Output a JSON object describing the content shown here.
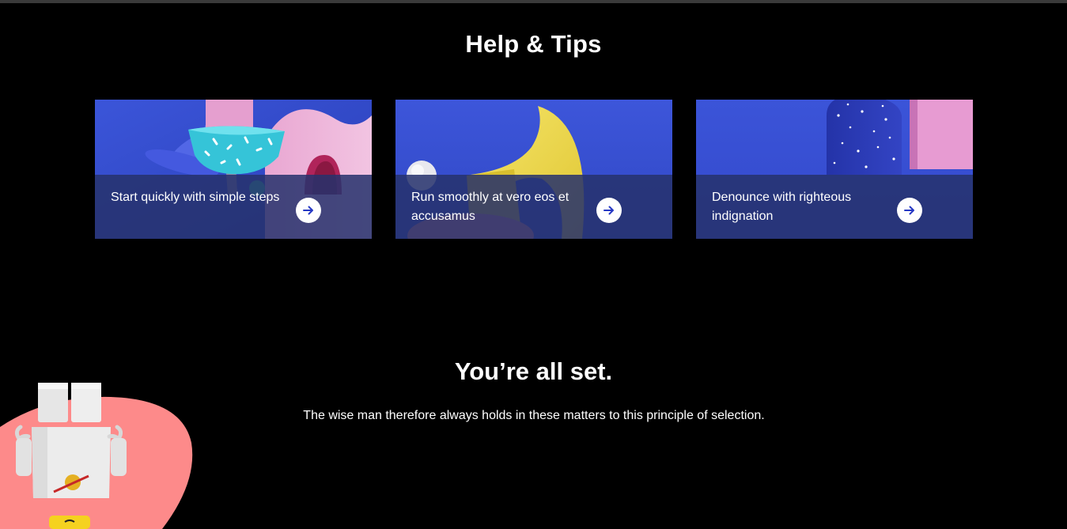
{
  "help": {
    "title": "Help & Tips",
    "cards": [
      {
        "label": "Start quickly with simple steps",
        "icon": "arrow-right-icon"
      },
      {
        "label": "Run smoothly at vero eos et accusamus",
        "icon": "arrow-right-icon"
      },
      {
        "label": "Denounce with righteous indignation",
        "icon": "arrow-right-icon"
      }
    ]
  },
  "finish": {
    "title": "You’re all set.",
    "description": "The wise man therefore always holds in these matters to this principle of selection."
  },
  "colors": {
    "background": "#000000",
    "card_blue": "#2f46c9",
    "overlay": "#26326c",
    "blob": "#fd8a8a",
    "arrow": "#2638c4"
  }
}
